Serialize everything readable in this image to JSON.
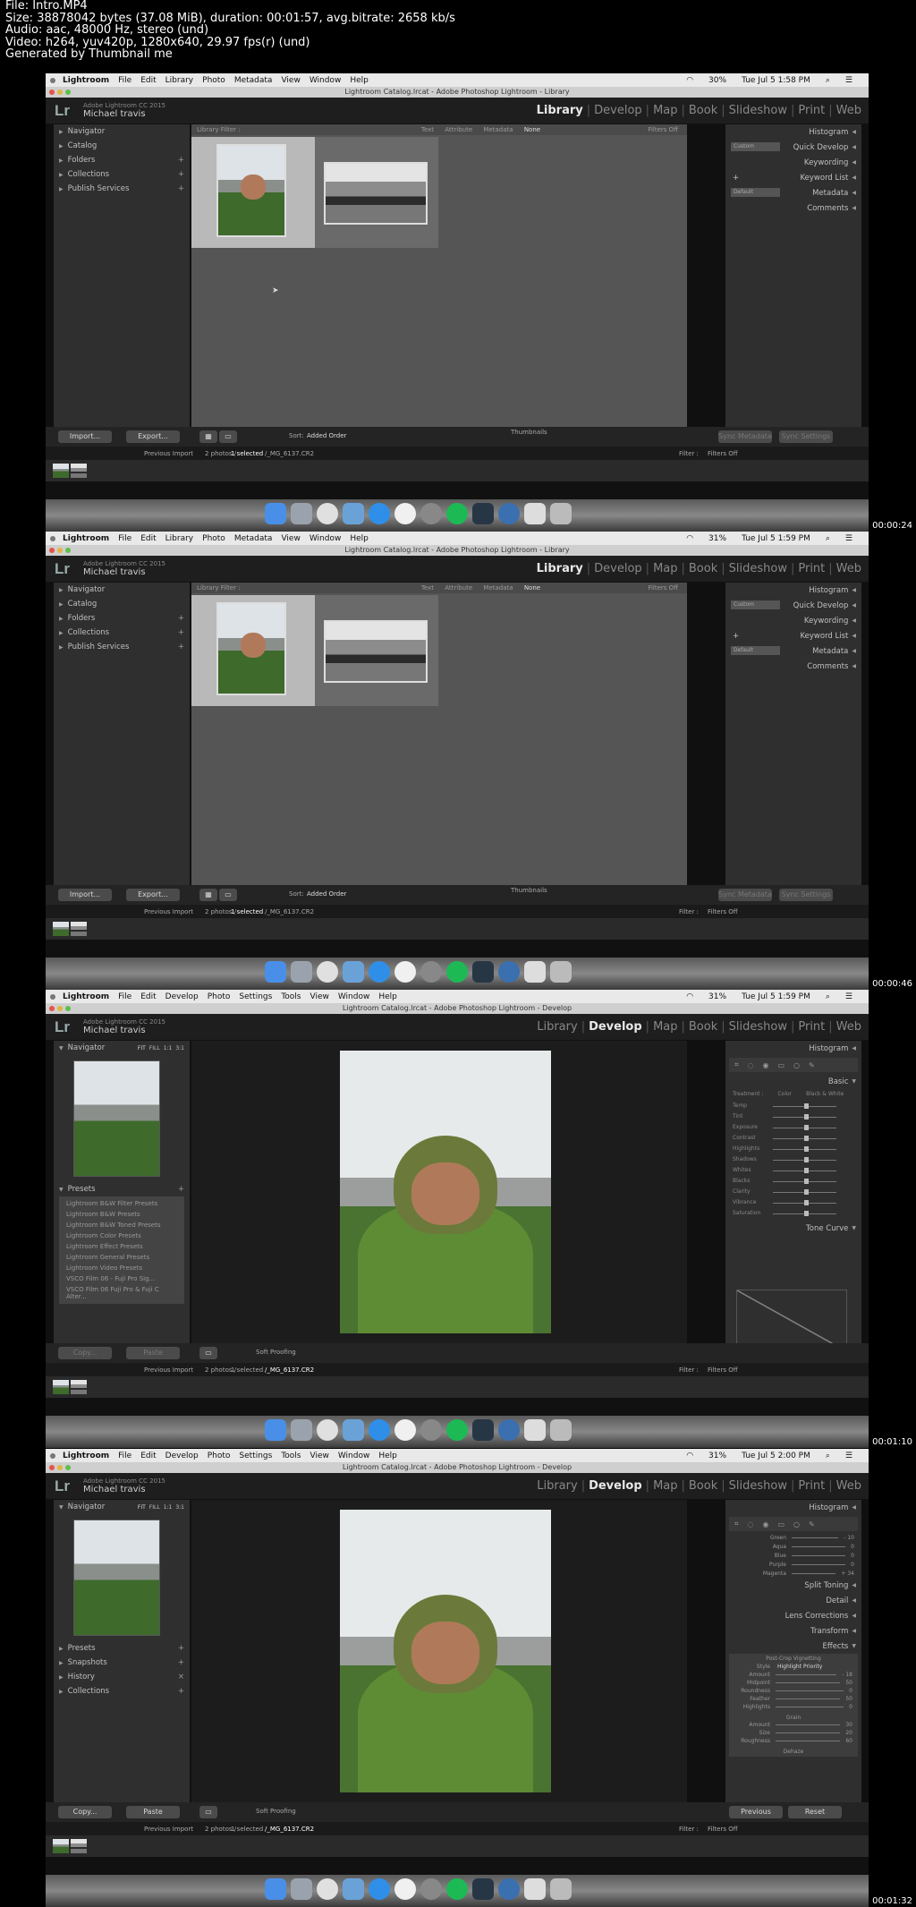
{
  "header": {
    "lines": [
      "File: Intro.MP4",
      "Size: 38878042 bytes (37.08 MiB), duration: 00:01:57, avg.bitrate: 2658 kb/s",
      "Audio: aac, 48000 Hz, stereo (und)",
      "Video: h264, yuv420p, 1280x640, 29.97 fps(r) (und)",
      "Generated by Thumbnail me"
    ]
  },
  "frames": [
    {
      "timestamp": "00:00:24",
      "clock": "Tue Jul 5  1:58 PM",
      "battery": "30%",
      "window_title": "Lightroom Catalog.lrcat - Adobe Photoshop Lightroom - Library",
      "module": "Library"
    },
    {
      "timestamp": "00:00:46",
      "clock": "Tue Jul 5  1:59 PM",
      "battery": "31%",
      "window_title": "Lightroom Catalog.lrcat - Adobe Photoshop Lightroom - Library",
      "module": "Library"
    },
    {
      "timestamp": "00:01:10",
      "clock": "Tue Jul 5  1:59 PM",
      "battery": "31%",
      "window_title": "Lightroom Catalog.lrcat - Adobe Photoshop Lightroom - Develop",
      "module": "Develop"
    },
    {
      "timestamp": "00:01:32",
      "clock": "Tue Jul 5  2:00 PM",
      "battery": "31%",
      "window_title": "Lightroom Catalog.lrcat - Adobe Photoshop Lightroom - Develop",
      "module": "Develop"
    }
  ],
  "menus": {
    "library": [
      "Lightroom",
      "File",
      "Edit",
      "Library",
      "Photo",
      "Metadata",
      "View",
      "Window",
      "Help"
    ],
    "develop": [
      "Lightroom",
      "File",
      "Edit",
      "Develop",
      "Photo",
      "Settings",
      "Tools",
      "View",
      "Window",
      "Help"
    ]
  },
  "identity": {
    "product": "Adobe Lightroom CC 2015",
    "user": "Michael travis",
    "logo": "Lr"
  },
  "modules": [
    "Library",
    "Develop",
    "Map",
    "Book",
    "Slideshow",
    "Print",
    "Web"
  ],
  "library": {
    "left_panels": [
      "Navigator",
      "Catalog",
      "Folders",
      "Collections",
      "Publish Services"
    ],
    "right_panels": [
      "Histogram",
      "Quick Develop",
      "Keywording",
      "Keyword List",
      "Metadata",
      "Comments"
    ],
    "quick_develop_preset": "Custom",
    "metadata_preset": "Default",
    "filter_bar": {
      "label": "Library Filter :",
      "options": [
        "Text",
        "Attribute",
        "Metadata",
        "None"
      ],
      "right": "Filters Off"
    },
    "import_label": "Import...",
    "export_label": "Export...",
    "sort_label": "Sort:",
    "sort_value": "Added Order",
    "thumbnails_label": "Thumbnails",
    "sync_metadata": "Sync Metadata",
    "sync_settings": "Sync Settings"
  },
  "develop1": {
    "left_panels": [
      "Navigator",
      "Presets"
    ],
    "nav_modes": [
      "FIT",
      "FILL",
      "1:1",
      "3:1"
    ],
    "presets": [
      "Lightroom B&W Filter Presets",
      "Lightroom B&W Presets",
      "Lightroom B&W Toned Presets",
      "Lightroom Color Presets",
      "Lightroom Effect Presets",
      "Lightroom General Presets",
      "Lightroom Video Presets",
      "VSCO Film 06 - Fuji Pro Sig...",
      "VSCO Film 06 Fuji Pro & Fuji C Alter..."
    ],
    "right_panels": [
      "Histogram",
      "Basic",
      "Tone Curve"
    ],
    "basic_treatment": [
      "Treatment :",
      "Color",
      "Black & White"
    ],
    "basic_sliders": [
      "Temp",
      "Tint",
      "Exposure",
      "Contrast",
      "Highlights",
      "Shadows",
      "Whites",
      "Blacks",
      "Clarity",
      "Vibrance",
      "Saturation"
    ],
    "copy_label": "Copy...",
    "paste_label": "Paste",
    "previous_label": "Previous",
    "reset_label": "Reset",
    "soft_proofing": "Soft Proofing"
  },
  "develop2": {
    "left_panels": [
      "Navigator",
      "Presets",
      "Snapshots",
      "History",
      "Collections"
    ],
    "hsl_sliders": [
      {
        "name": "Green",
        "value": "- 10"
      },
      {
        "name": "Aqua",
        "value": "0"
      },
      {
        "name": "Blue",
        "value": "0"
      },
      {
        "name": "Purple",
        "value": "0"
      },
      {
        "name": "Magenta",
        "value": "+ 34"
      }
    ],
    "right_panels": [
      "Split Toning",
      "Detail",
      "Lens Corrections",
      "Transform",
      "Effects"
    ],
    "vignette_title": "Post-Crop Vignetting",
    "vignette_style_label": "Style",
    "vignette_style": "Highlight Priority",
    "vignette_sliders": [
      {
        "name": "Amount",
        "value": "- 18"
      },
      {
        "name": "Midpoint",
        "value": "50"
      },
      {
        "name": "Roundness",
        "value": "0"
      },
      {
        "name": "Feather",
        "value": "50"
      },
      {
        "name": "Highlights",
        "value": "0"
      }
    ],
    "grain_title": "Grain",
    "grain_sliders": [
      {
        "name": "Amount",
        "value": "30"
      },
      {
        "name": "Size",
        "value": "20"
      },
      {
        "name": "Roughness",
        "value": "60"
      }
    ],
    "dehaze": "Dehaze"
  },
  "status": {
    "source": "Previous Import",
    "count": "2 photos /",
    "selected": "1 selected",
    "file": "/_MG_6137.CR2",
    "filter_label": "Filter :",
    "filter_value": "Filters Off"
  }
}
